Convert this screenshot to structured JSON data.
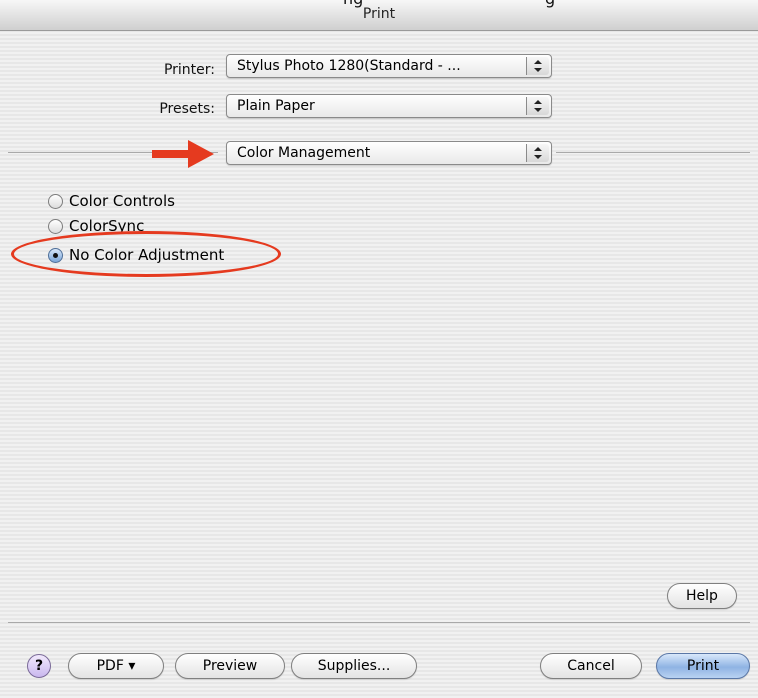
{
  "window": {
    "clipped_caption": "ng",
    "clipped_caption2": "g",
    "title": "Print"
  },
  "printer": {
    "label": "Printer:",
    "value": "Stylus Photo 1280(Standard - ..."
  },
  "presets": {
    "label": "Presets:",
    "value": "Plain Paper"
  },
  "panel_selector": {
    "value": "Color Management"
  },
  "color_options": [
    {
      "label": "Color Controls",
      "selected": false
    },
    {
      "label": "ColorSync",
      "selected": false
    },
    {
      "label": "No Color Adjustment",
      "selected": true
    }
  ],
  "buttons": {
    "help": "Help",
    "help_round": "?",
    "pdf": "PDF ▾",
    "preview": "Preview",
    "supplies": "Supplies...",
    "cancel": "Cancel",
    "print": "Print"
  },
  "annotation_color": "#e53a1f",
  "icons": {
    "stepper": "up-down-arrows-icon",
    "arrow": "right-arrow-annotation-icon"
  }
}
